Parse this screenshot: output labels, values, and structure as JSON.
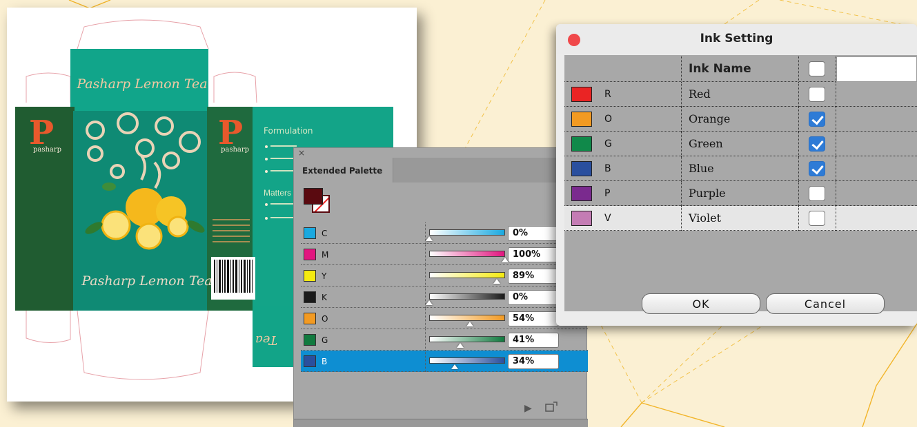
{
  "colors": {
    "background": "#fbf0d3",
    "box_dark_green": "#205c31",
    "box_teal": "#0f9b80",
    "selection_blue": "#0e8ed2",
    "check_blue": "#2e7bd6"
  },
  "artwork": {
    "top_title": "Pasharp Lemon Tea",
    "front_title": "Pasharp Lemon Tea",
    "logo_letter": "P",
    "logo_name": "pasharp",
    "side_heading": "Formulation",
    "side_heading_2": "Matters",
    "flap_text": "Tea"
  },
  "palette": {
    "close_icon": "close-icon",
    "tab_label": "Extended Palette",
    "rows": [
      {
        "label": "C",
        "color": "#1aa9e0",
        "value": "0%",
        "fraction": 0.0,
        "grad_to": "#1aa9e0"
      },
      {
        "label": "M",
        "color": "#e2157f",
        "value": "100%",
        "fraction": 1.0,
        "grad_to": "#e2157f"
      },
      {
        "label": "Y",
        "color": "#f4ea10",
        "value": "89%",
        "fraction": 0.89,
        "grad_to": "#f4ea10"
      },
      {
        "label": "K",
        "color": "#1a1a1a",
        "value": "0%",
        "fraction": 0.0,
        "grad_to": "#1a1a1a"
      },
      {
        "label": "O",
        "color": "#f29a22",
        "value": "54%",
        "fraction": 0.54,
        "grad_to": "#f29a22"
      },
      {
        "label": "G",
        "color": "#117a3f",
        "value": "41%",
        "fraction": 0.41,
        "grad_to": "#117a3f"
      },
      {
        "label": "B",
        "color": "#2a4f9e",
        "value": "34%",
        "fraction": 0.34,
        "grad_to": "#2a4f9e",
        "selected": true
      }
    ],
    "play_icon": "play-icon",
    "new_icon": "new-swatch-icon"
  },
  "ink_dialog": {
    "title": "Ink Setting",
    "header_name": "Ink Name",
    "header_checked": false,
    "inks": [
      {
        "letter": "R",
        "name": "Red",
        "color": "#ea2424",
        "checked": false
      },
      {
        "letter": "O",
        "name": "Orange",
        "color": "#f29a22",
        "checked": true
      },
      {
        "letter": "G",
        "name": "Green",
        "color": "#10894a",
        "checked": true
      },
      {
        "letter": "B",
        "name": "Blue",
        "color": "#2a4f9e",
        "checked": true
      },
      {
        "letter": "P",
        "name": "Purple",
        "color": "#7a2a8e",
        "checked": false
      },
      {
        "letter": "V",
        "name": "Violet",
        "color": "#c47cb4",
        "checked": false,
        "selected": true
      }
    ],
    "ok_label": "OK",
    "cancel_label": "Cancel"
  }
}
